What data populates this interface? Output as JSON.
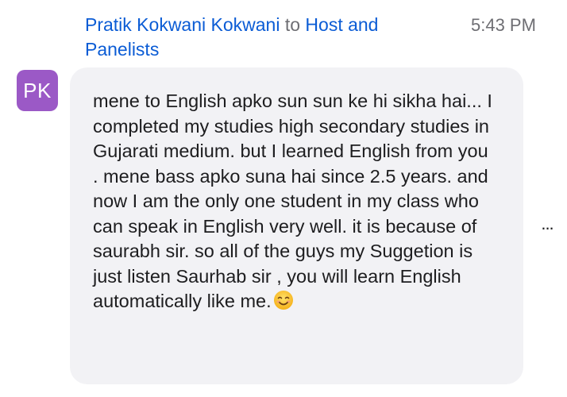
{
  "header": {
    "sender": "Pratik Kokwani Kokwani",
    "to_word": "to",
    "recipient": "Host and Panelists",
    "time": "5:43 PM"
  },
  "avatar": {
    "initials": "PK",
    "color": "#9b59c6"
  },
  "message": {
    "text": "mene to English apko sun sun ke hi sikha hai... I completed my studies high secondary studies in Gujarati medium. but I learned English from you . mene bass apko suna hai since 2.5 years. and now I am the only one student in my class who can speak in English very well. it is because of saurabh sir. so all of the guys my Suggetion is just listen Saurhab sir , you will learn English automatically like me.",
    "emoji": "smiling-face-icon"
  },
  "actions": {
    "more_label": "..."
  },
  "colors": {
    "link": "#0b5cd5",
    "bubble": "#f2f2f5",
    "muted": "#6e6e73"
  }
}
